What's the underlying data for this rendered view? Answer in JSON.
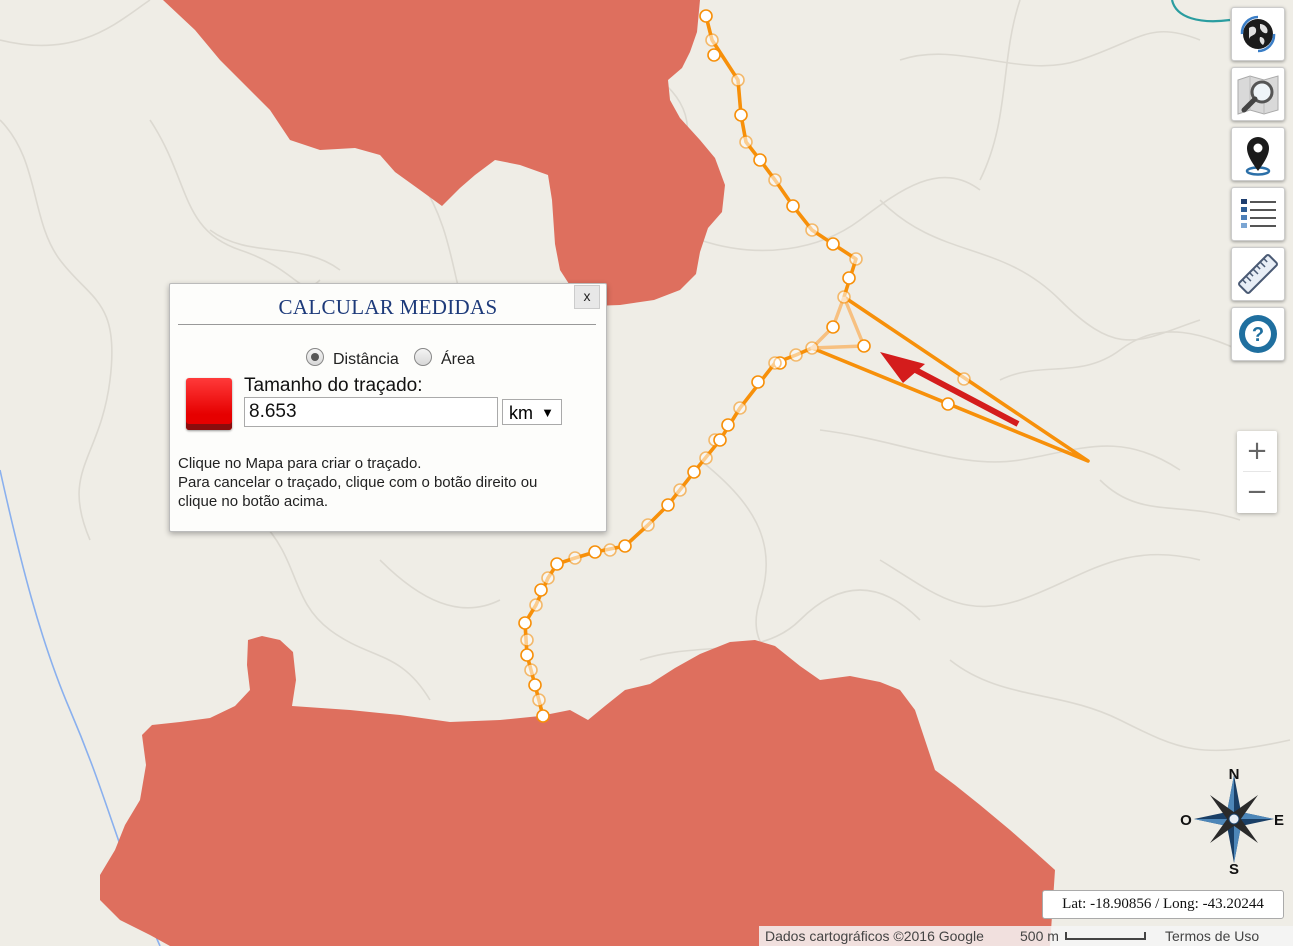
{
  "panel": {
    "title": "CALCULAR MEDIDAS",
    "close_label": "x",
    "mode_distance": "Distância",
    "mode_area": "Área",
    "selected_mode": "Distância",
    "length_label": "Tamanho do traçado:",
    "length_value": "8.653",
    "unit": "km",
    "line_color": "#e60000",
    "instructions": [
      "Clique no Mapa para criar o traçado.",
      "Para cancelar o traçado, clique com o botão direito ou",
      "clique no botão acima."
    ]
  },
  "toolbar": {
    "buttons": [
      "globe-icon",
      "map-search-icon",
      "map-pin-icon",
      "layers-list-icon",
      "ruler-icon",
      "help-icon"
    ]
  },
  "zoom": {
    "in_label": "+",
    "out_label": "−"
  },
  "compass": {
    "north": "N",
    "south": "S",
    "east": "E",
    "west": "O"
  },
  "coordinates": {
    "text": "Lat: -18.90856 / Long: -43.20244"
  },
  "attribution": {
    "map_data": "Dados cartográficos ©2016 Google",
    "scale": "500 m",
    "terms": "Termos de Uso"
  },
  "colors": {
    "land": "#efede6",
    "area_fill": "#de6f5e",
    "route": "#f7900a",
    "arrow": "#d41c1c",
    "river": "#2a9da0",
    "stream": "#8ab0ee"
  }
}
